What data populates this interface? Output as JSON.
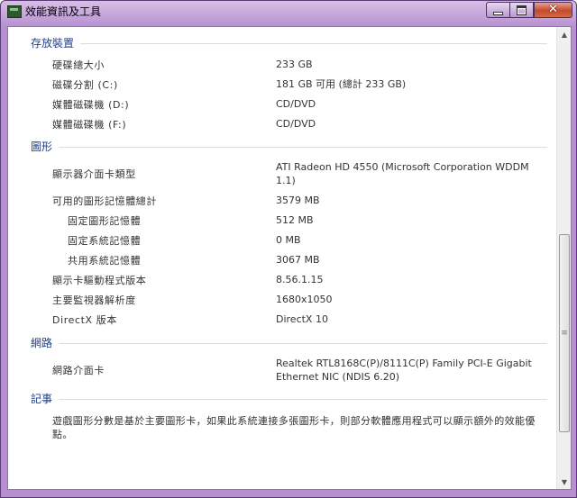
{
  "window": {
    "title": "效能資訊及工具"
  },
  "sections": {
    "storage": {
      "title": "存放裝置",
      "rows": [
        {
          "label": "硬碟總大小",
          "value": "233 GB"
        },
        {
          "label": "磁碟分割 (C:)",
          "value": "181 GB 可用 (總計 233 GB)"
        },
        {
          "label": "媒體磁碟機 (D:)",
          "value": "CD/DVD"
        },
        {
          "label": "媒體磁碟機 (F:)",
          "value": "CD/DVD"
        }
      ]
    },
    "graphics": {
      "title": "圖形",
      "rows": [
        {
          "label": "顯示器介面卡類型",
          "value": "ATI Radeon HD 4550 (Microsoft Corporation WDDM 1.1)"
        },
        {
          "label": "可用的圖形記憶體總計",
          "value": "3579 MB"
        },
        {
          "label": "固定圖形記憶體",
          "value": "512 MB"
        },
        {
          "label": "固定系統記憶體",
          "value": "0 MB"
        },
        {
          "label": "共用系統記憶體",
          "value": "3067 MB"
        },
        {
          "label": "顯示卡驅動程式版本",
          "value": "8.56.1.15"
        },
        {
          "label": "主要監視器解析度",
          "value": "1680x1050"
        },
        {
          "label": "DirectX 版本",
          "value": "DirectX 10"
        }
      ]
    },
    "network": {
      "title": "網路",
      "rows": [
        {
          "label": "網路介面卡",
          "value": "Realtek RTL8168C(P)/8111C(P) Family PCI-E Gigabit Ethernet NIC (NDIS 6.20)"
        }
      ]
    },
    "notes": {
      "title": "記事",
      "text": "遊戲圖形分數是基於主要圖形卡，如果此系統連接多張圖形卡，則部分軟體應用程式可以顯示額外的效能優點。"
    }
  },
  "icons": {
    "app": "performance-info-icon",
    "minimize": "minimize-icon",
    "maximize": "maximize-icon",
    "close": "close-icon",
    "scroll_up": "scroll-up-arrow-icon",
    "scroll_down": "scroll-down-arrow-icon"
  }
}
